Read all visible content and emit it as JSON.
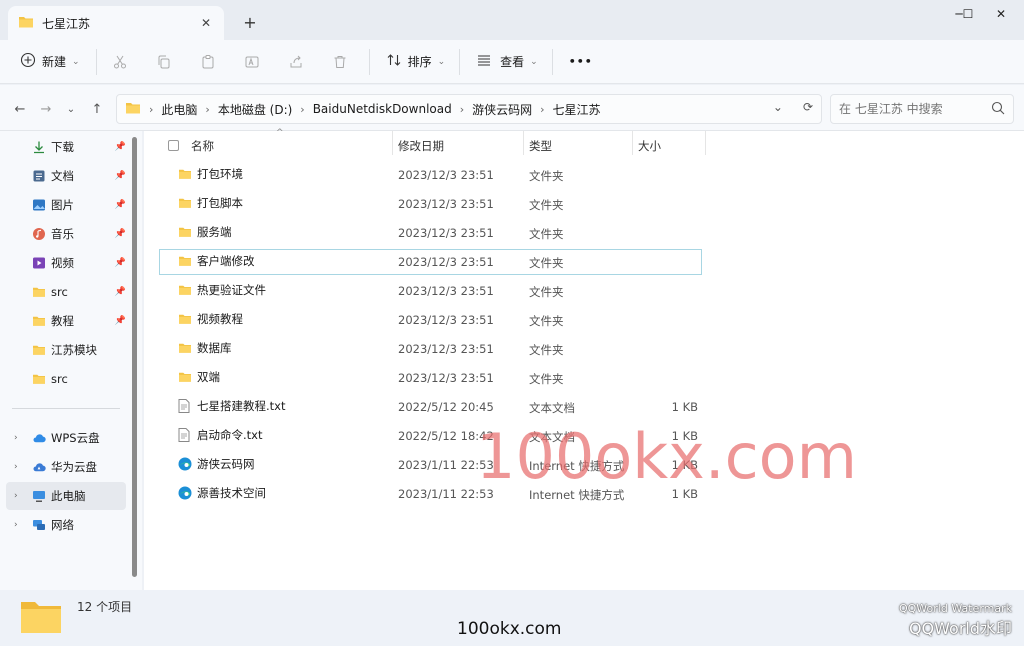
{
  "tab": {
    "title": "七星江苏",
    "close": "✕",
    "new": "+"
  },
  "window": {
    "minimize": "─",
    "maximize": "☐",
    "close": "✕"
  },
  "toolbar": {
    "new_label": "新建",
    "sort_label": "排序",
    "view_label": "查看",
    "more_label": "•••"
  },
  "address": {
    "crumbs": [
      "此电脑",
      "本地磁盘 (D:)",
      "BaiduNetdiskDownload",
      "游侠云码网",
      "七星江苏"
    ],
    "search_placeholder": "在 七星江苏 中搜索"
  },
  "sidebar": {
    "items": [
      {
        "label": "下载",
        "icon": "download-icon",
        "pinned": true
      },
      {
        "label": "文档",
        "icon": "document-icon",
        "pinned": true
      },
      {
        "label": "图片",
        "icon": "picture-icon",
        "pinned": true
      },
      {
        "label": "音乐",
        "icon": "music-icon",
        "pinned": true
      },
      {
        "label": "视频",
        "icon": "video-icon",
        "pinned": true
      },
      {
        "label": "src",
        "icon": "folder-icon",
        "pinned": true
      },
      {
        "label": "教程",
        "icon": "folder-icon",
        "pinned": true
      },
      {
        "label": "江苏模块",
        "icon": "folder-icon",
        "pinned": false
      },
      {
        "label": "src",
        "icon": "folder-icon",
        "pinned": false
      }
    ],
    "roots": [
      {
        "label": "WPS云盘",
        "icon": "cloud-icon"
      },
      {
        "label": "华为云盘",
        "icon": "cloud-icon"
      },
      {
        "label": "此电脑",
        "icon": "computer-icon"
      },
      {
        "label": "网络",
        "icon": "network-icon"
      }
    ]
  },
  "columns": {
    "name": "名称",
    "date": "修改日期",
    "type": "类型",
    "size": "大小"
  },
  "files": [
    {
      "name": "打包环境",
      "date": "2023/12/3 23:51",
      "type": "文件夹",
      "size": "",
      "icon": "folder"
    },
    {
      "name": "打包脚本",
      "date": "2023/12/3 23:51",
      "type": "文件夹",
      "size": "",
      "icon": "folder"
    },
    {
      "name": "服务端",
      "date": "2023/12/3 23:51",
      "type": "文件夹",
      "size": "",
      "icon": "folder"
    },
    {
      "name": "客户端修改",
      "date": "2023/12/3 23:51",
      "type": "文件夹",
      "size": "",
      "icon": "folder"
    },
    {
      "name": "热更验证文件",
      "date": "2023/12/3 23:51",
      "type": "文件夹",
      "size": "",
      "icon": "folder"
    },
    {
      "name": "视频教程",
      "date": "2023/12/3 23:51",
      "type": "文件夹",
      "size": "",
      "icon": "folder"
    },
    {
      "name": "数据库",
      "date": "2023/12/3 23:51",
      "type": "文件夹",
      "size": "",
      "icon": "folder"
    },
    {
      "name": "双端",
      "date": "2023/12/3 23:51",
      "type": "文件夹",
      "size": "",
      "icon": "folder"
    },
    {
      "name": "七星搭建教程.txt",
      "date": "2022/5/12 20:45",
      "type": "文本文档",
      "size": "1 KB",
      "icon": "text"
    },
    {
      "name": "启动命令.txt",
      "date": "2022/5/12 18:42",
      "type": "文本文档",
      "size": "1 KB",
      "icon": "text"
    },
    {
      "name": "游侠云码网",
      "date": "2023/1/11 22:53",
      "type": "Internet 快捷方式",
      "size": "1 KB",
      "icon": "edge"
    },
    {
      "name": "源善技术空间",
      "date": "2023/1/11 22:53",
      "type": "Internet 快捷方式",
      "size": "1 KB",
      "icon": "edge"
    }
  ],
  "status": {
    "count": "12 个项目"
  },
  "watermark": {
    "main": "100okx.com",
    "bottom": "100okx.com",
    "qq_small": "QQWorld Watermark",
    "qq_big": "QQWorld水印"
  }
}
